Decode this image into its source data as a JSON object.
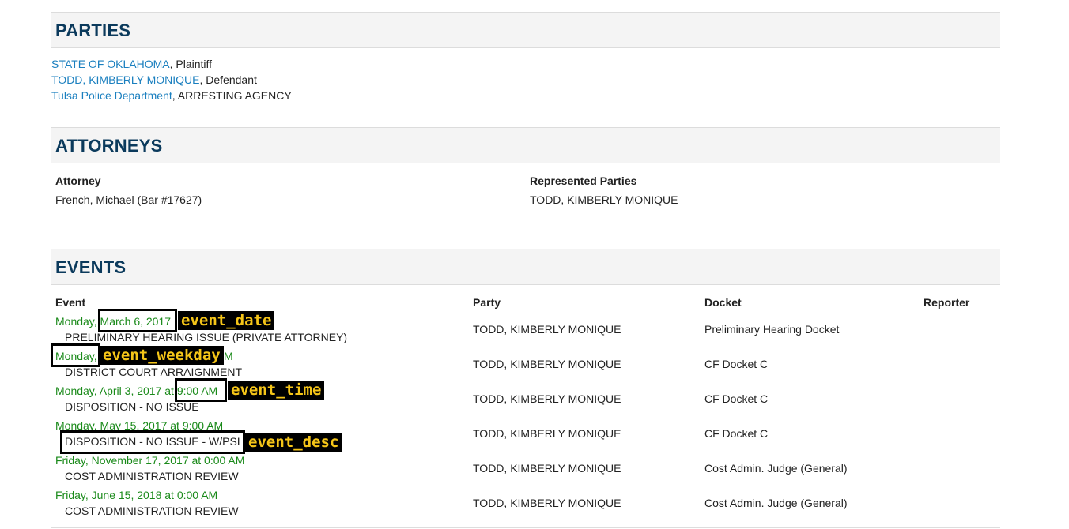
{
  "parties": {
    "title": "PARTIES",
    "items": [
      {
        "name": "STATE OF OKLAHOMA",
        "role": ", Plaintiff"
      },
      {
        "name": "TODD,  KIMBERLY  MONIQUE",
        "role": ", Defendant"
      },
      {
        "name": "Tulsa Police Department",
        "role": ", ARRESTING AGENCY"
      }
    ]
  },
  "attorneys": {
    "title": "ATTORNEYS",
    "headers": {
      "attorney": "Attorney",
      "represented": "Represented Parties"
    },
    "rows": [
      {
        "attorney": "French,  Michael (Bar #17627)",
        "represented": "TODD,   KIMBERLY  MONIQUE"
      }
    ]
  },
  "events": {
    "title": "EVENTS",
    "headers": {
      "event": "Event",
      "party": "Party",
      "docket": "Docket",
      "reporter": "Reporter"
    },
    "rows": [
      {
        "when": "Monday, March 6, 2017",
        "desc": "PRELIMINARY HEARING ISSUE (PRIVATE ATTORNEY)",
        "party": "TODD,  KIMBERLY  MONIQUE",
        "docket": "Preliminary Hearing Docket"
      },
      {
        "when": "Monday, March 13, 2017 at 9:00 AM",
        "desc": "DISTRICT COURT ARRAIGNMENT",
        "party": "TODD,  KIMBERLY  MONIQUE",
        "docket": "CF Docket C"
      },
      {
        "when": "Monday, April 3, 2017 at 9:00 AM",
        "desc": "DISPOSITION - NO ISSUE",
        "party": "TODD,  KIMBERLY  MONIQUE",
        "docket": "CF Docket C"
      },
      {
        "when": "Monday, May 15, 2017 at 9:00 AM",
        "desc": "DISPOSITION - NO ISSUE - W/PSI",
        "party": "TODD,  KIMBERLY  MONIQUE",
        "docket": "CF Docket C"
      },
      {
        "when": "Friday, November 17, 2017 at 0:00 AM",
        "desc": "COST ADMINISTRATION REVIEW",
        "party": "TODD,  KIMBERLY  MONIQUE",
        "docket": "Cost Admin. Judge (General)"
      },
      {
        "when": "Friday, June 15, 2018 at 0:00 AM",
        "desc": "COST ADMINISTRATION REVIEW",
        "party": "TODD,  KIMBERLY  MONIQUE",
        "docket": "Cost Admin. Judge (General)"
      }
    ]
  },
  "annotations": {
    "event_date": "event_date",
    "event_weekday": "event_weekday",
    "event_time": "event_time",
    "event_desc": "event_desc"
  }
}
